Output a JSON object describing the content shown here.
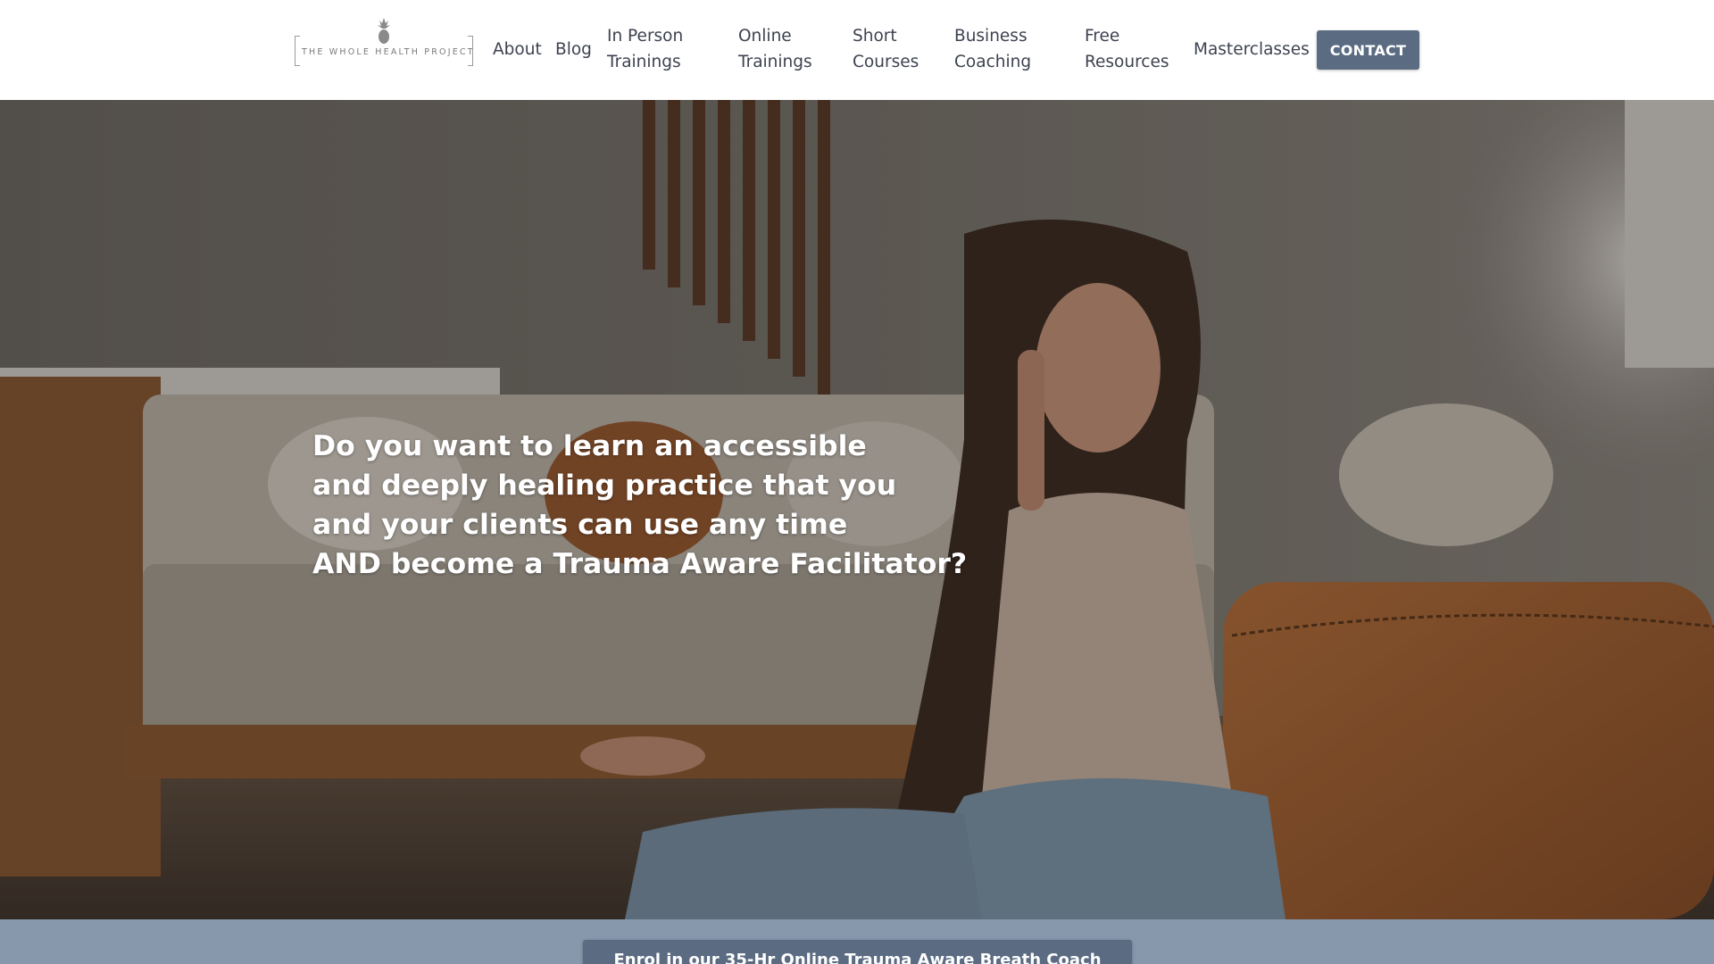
{
  "logo": {
    "text": "THE WHOLE HEALTH PROJECT",
    "icon": "pineapple-icon"
  },
  "nav": {
    "items": [
      {
        "label": "About"
      },
      {
        "label": "Blog"
      },
      {
        "label": "In Person Trainings"
      },
      {
        "label": "Online Trainings"
      },
      {
        "label": "Short Courses"
      },
      {
        "label": "Business Coaching"
      },
      {
        "label": "Free Resources"
      },
      {
        "label": "Masterclasses"
      }
    ],
    "contact_label": "CONTACT"
  },
  "hero": {
    "heading_lines": [
      "Do you want to learn an accessible",
      "and deeply healing practice that you",
      "and your clients can use any time",
      "AND become a Trauma Aware Facilitator?"
    ]
  },
  "cta": {
    "label": "Enrol in our 35-Hr Online Trauma Aware Breath Coach"
  },
  "colors": {
    "accent": "#5a6b82",
    "band": "#8797ac",
    "nav_text": "#3d4250"
  }
}
